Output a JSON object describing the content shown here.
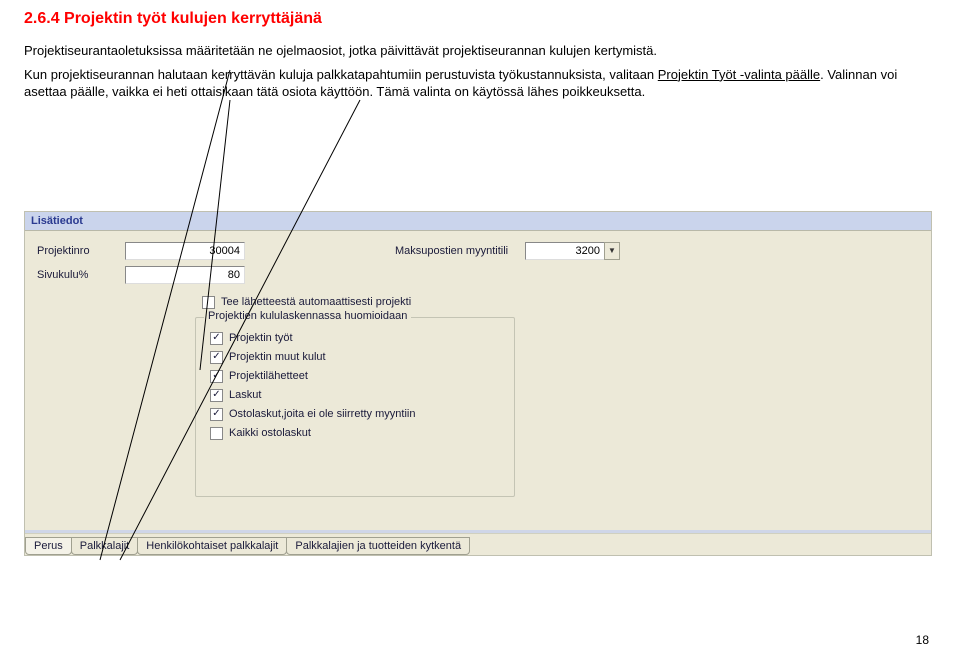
{
  "heading": "2.6.4 Projektin työt kulujen kerryttäjänä",
  "para1": "Projektiseurantaoletuksissa määritetään ne ojelmaosiot, jotka päivittävät projektiseurannan kulujen kertymistä.",
  "para2_a": "Kun projektiseurannan halutaan kerryttävän kuluja palkkatapahtumiin perustuvista työkustannuksista, valitaan ",
  "para2_u": "Projektin Työt -valinta päälle",
  "para2_b": ". Valinnan voi asettaa päälle, vaikka ei heti ottaisikaan tätä osiota käyttöön. Tämä valinta on käytössä lähes poikkeuksetta.",
  "panel": {
    "title": "Lisätiedot",
    "projektinro_label": "Projektinro",
    "projektinro_value": "30004",
    "maksupostien_label": "Maksupostien myyntitili",
    "maksupostien_value": "3200",
    "sivukulu_label": "Sivukulu%",
    "sivukulu_value": "80",
    "lone_check_label": "Tee lähetteestä automaattisesti projekti",
    "groupbox_title": "Projektien kululaskennassa huomioidaan",
    "checks": [
      {
        "label": "Projektin työt",
        "checked": true
      },
      {
        "label": "Projektin muut kulut",
        "checked": true
      },
      {
        "label": "Projektilähetteet",
        "checked": true
      },
      {
        "label": "Laskut",
        "checked": true
      },
      {
        "label": "Ostolaskut,joita ei ole siirretty myyntiin",
        "checked": true
      },
      {
        "label": "Kaikki ostolaskut",
        "checked": false
      }
    ],
    "tabs": [
      "Perus",
      "Palkkalajit",
      "Henkilökohtaiset palkkalajit",
      "Palkkalajien ja tuotteiden kytkentä"
    ]
  },
  "page_number": "18"
}
